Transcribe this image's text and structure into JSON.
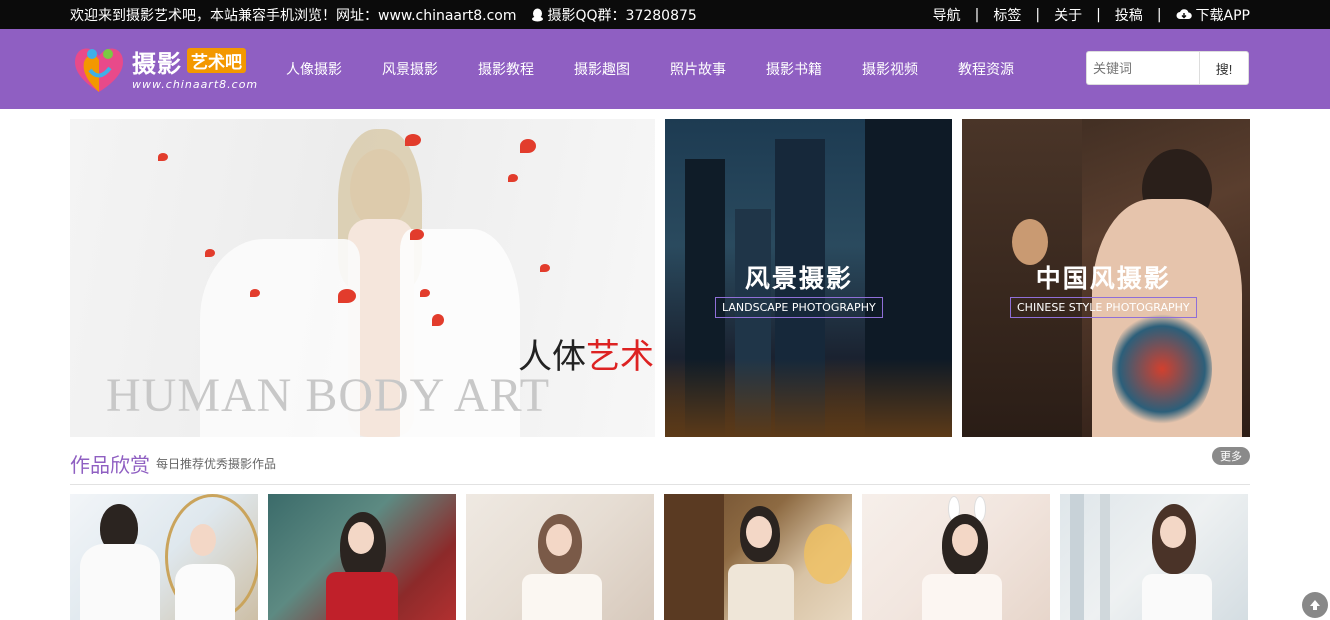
{
  "topbar": {
    "welcome": "欢迎来到摄影艺术吧，本站兼容手机浏览！网址：www.chinaart8.com",
    "qq_label": "摄影QQ群：37280875",
    "links": [
      "导航",
      "标签",
      "关于",
      "投稿"
    ],
    "download": "下载APP"
  },
  "header": {
    "logo_text": "摄影",
    "logo_badge": "艺术吧",
    "logo_url": "www.chinaart8.com",
    "nav": [
      "人像摄影",
      "风景摄影",
      "摄影教程",
      "摄影趣图",
      "照片故事",
      "摄影书籍",
      "摄影视频",
      "教程资源"
    ],
    "search_placeholder": "关键词",
    "search_button": "搜!"
  },
  "banner": {
    "main_cn_1": "人体",
    "main_cn_2": "艺术",
    "main_en": "HUMAN BODY ART",
    "card2_cn": "风景摄影",
    "card2_en": "LANDSCAPE PHOTOGRAPHY",
    "card3_cn": "中国风摄影",
    "card3_en": "CHINESE STYLE PHOTOGRAPHY"
  },
  "section": {
    "title": "作品欣赏",
    "subtitle": "每日推荐优秀摄影作品",
    "more": "更多"
  },
  "colors": {
    "header_bg": "#8f5fc2",
    "topbar_bg": "#0b0b0b",
    "accent": "#f39800"
  },
  "icons": {
    "qq": "qq-icon",
    "download": "cloud-download-icon",
    "to_top": "arrow-up-icon"
  }
}
